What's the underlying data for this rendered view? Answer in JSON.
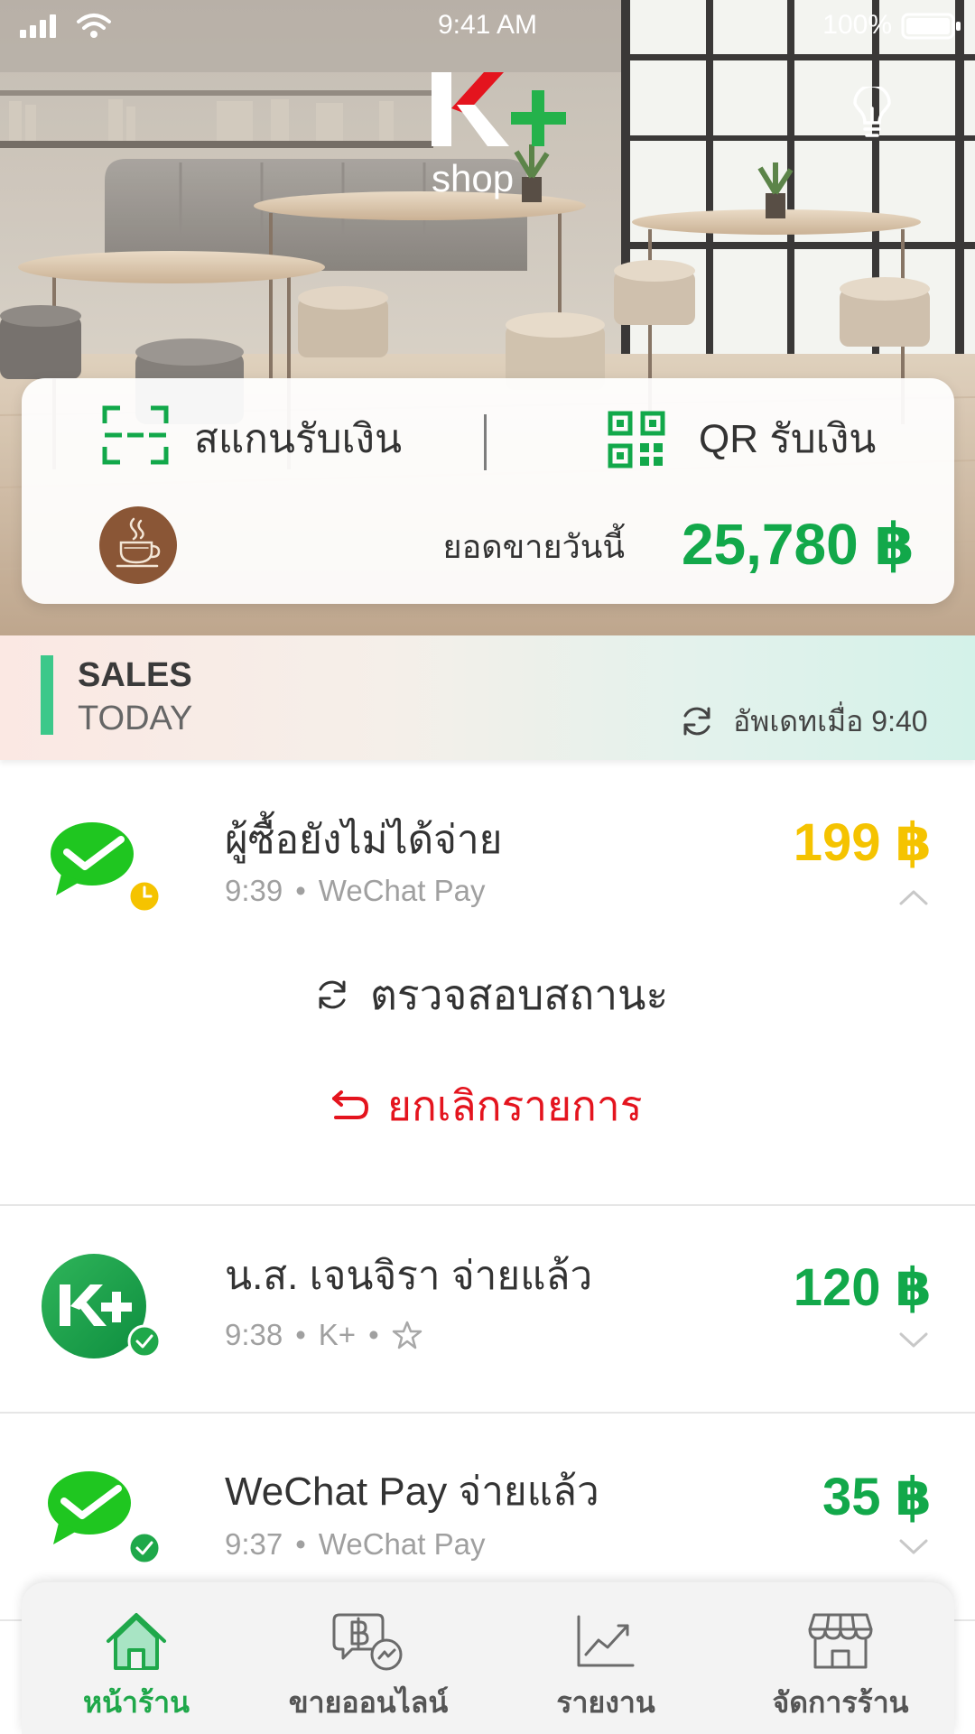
{
  "status_bar": {
    "time": "9:41 AM",
    "battery": "100%",
    "icons": [
      "signal-icon",
      "wifi-icon",
      "battery-icon"
    ]
  },
  "header": {
    "logo_lettering": "K+",
    "logo_sub": "shop",
    "help_icon": "lightbulb-icon"
  },
  "quick_actions": {
    "scan": {
      "label": "สแกนรับเงิน",
      "icon": "scan-icon"
    },
    "qr": {
      "label": "QR รับเงิน",
      "icon": "qr-code-icon"
    }
  },
  "shop": {
    "avatar_icon": "coffee-cup-icon"
  },
  "today_sales": {
    "label": "ยอดขายวันนี้",
    "amount": "25,780 ฿"
  },
  "sales_banner": {
    "title_line1": "SALES",
    "title_line2": "TODAY",
    "updated_text": "อัพเดทเมื่อ 9:40",
    "refresh_icon": "refresh-icon"
  },
  "meta_separator": "•",
  "transactions": [
    {
      "title": "ผู้ซื้อยังไม่ได้จ่าย",
      "time": "9:39",
      "channel": "WeChat Pay",
      "amount": "199 ฿",
      "icon": "wechat-pay-icon",
      "badge_icon": "clock-icon",
      "expanded": true,
      "actions": {
        "check_status": "ตรวจสอบสถานะ",
        "cancel": "ยกเลิกรายการ"
      }
    },
    {
      "title": "น.ส. เจนจิรา จ่ายแล้ว",
      "time": "9:38",
      "channel": "K+",
      "amount": "120 ฿",
      "icon": "k-plus-icon",
      "badge_icon": "check-icon",
      "favorite_icon": "star-icon",
      "expanded": false
    },
    {
      "title": "WeChat Pay จ่ายแล้ว",
      "time": "9:37",
      "channel": "WeChat Pay",
      "amount": "35 ฿",
      "icon": "wechat-pay-icon",
      "badge_icon": "check-icon",
      "expanded": false
    }
  ],
  "bottom_nav": [
    {
      "label": "หน้าร้าน",
      "icon": "home-icon",
      "active": true
    },
    {
      "label": "ขายออนไลน์",
      "icon": "online-sales-icon",
      "active": false
    },
    {
      "label": "รายงาน",
      "icon": "report-chart-icon",
      "active": false
    },
    {
      "label": "จัดการร้าน",
      "icon": "store-manage-icon",
      "active": false
    }
  ],
  "colors": {
    "brand_green": "#12A84A",
    "pending_yellow": "#F5C300",
    "cancel_red": "#E4141E",
    "active_tab": "#1FA84A",
    "inactive_tab": "#555555",
    "wechat_green": "#1FC620"
  }
}
